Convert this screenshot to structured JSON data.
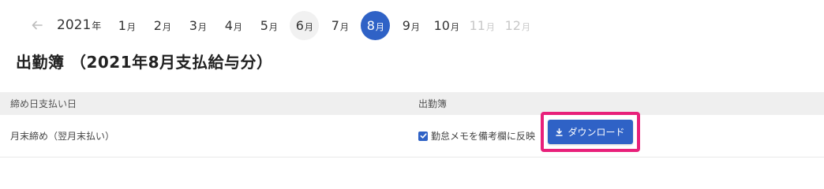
{
  "nav": {
    "year_num": "2021",
    "year_unit": "年",
    "months": [
      {
        "num": "1",
        "unit": "月",
        "state": "normal"
      },
      {
        "num": "2",
        "unit": "月",
        "state": "normal"
      },
      {
        "num": "3",
        "unit": "月",
        "state": "normal"
      },
      {
        "num": "4",
        "unit": "月",
        "state": "normal"
      },
      {
        "num": "5",
        "unit": "月",
        "state": "normal"
      },
      {
        "num": "6",
        "unit": "月",
        "state": "hover"
      },
      {
        "num": "7",
        "unit": "月",
        "state": "normal"
      },
      {
        "num": "8",
        "unit": "月",
        "state": "active"
      },
      {
        "num": "9",
        "unit": "月",
        "state": "normal"
      },
      {
        "num": "10",
        "unit": "月",
        "state": "normal"
      },
      {
        "num": "11",
        "unit": "月",
        "state": "disabled"
      },
      {
        "num": "12",
        "unit": "月",
        "state": "disabled"
      }
    ]
  },
  "title": "出勤簿 （2021年8月支払給与分）",
  "table": {
    "headers": [
      "締め日支払い日",
      "出勤簿"
    ],
    "rows": [
      {
        "cutoff": "月末締め（翌月末払い）",
        "checkbox_label": "勤怠メモを備考欄に反映",
        "checked": true,
        "download_label": "ダウンロード"
      }
    ]
  },
  "colors": {
    "accent": "#2f62c6",
    "highlight": "#e8207a"
  }
}
